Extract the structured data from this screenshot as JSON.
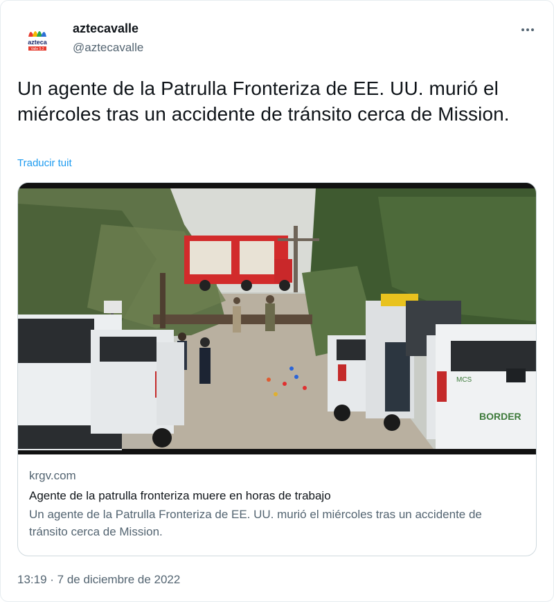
{
  "account": {
    "display_name": "aztecavalle",
    "handle": "@aztecavalle",
    "avatar_text": "azteca",
    "avatar_subtext": "Valle 5.2"
  },
  "menu_icon": "more-horizontal-icon",
  "tweet": {
    "text": "Un agente de la Patrulla Fronteriza de EE. UU. murió el miércoles tras un accidente de tránsito cerca de Mission.",
    "translate_link": "Traducir tuit",
    "timestamp": "13:19 · 7 de diciembre de 2022"
  },
  "card": {
    "domain": "krgv.com",
    "title": "Agente de la patrulla fronteriza muere en horas de trabajo",
    "description": "Un agente de la Patrulla Fronteriza de EE. UU. murió el miércoles tras un accidente de tránsito cerca de Mission.",
    "image_text_vehicle": "BORDER",
    "image_text_vehicle_small": "MCS"
  },
  "colors": {
    "link": "#1d9bf0",
    "secondary_text": "#536471",
    "primary_text": "#0f1419",
    "border": "#cfd9de"
  }
}
